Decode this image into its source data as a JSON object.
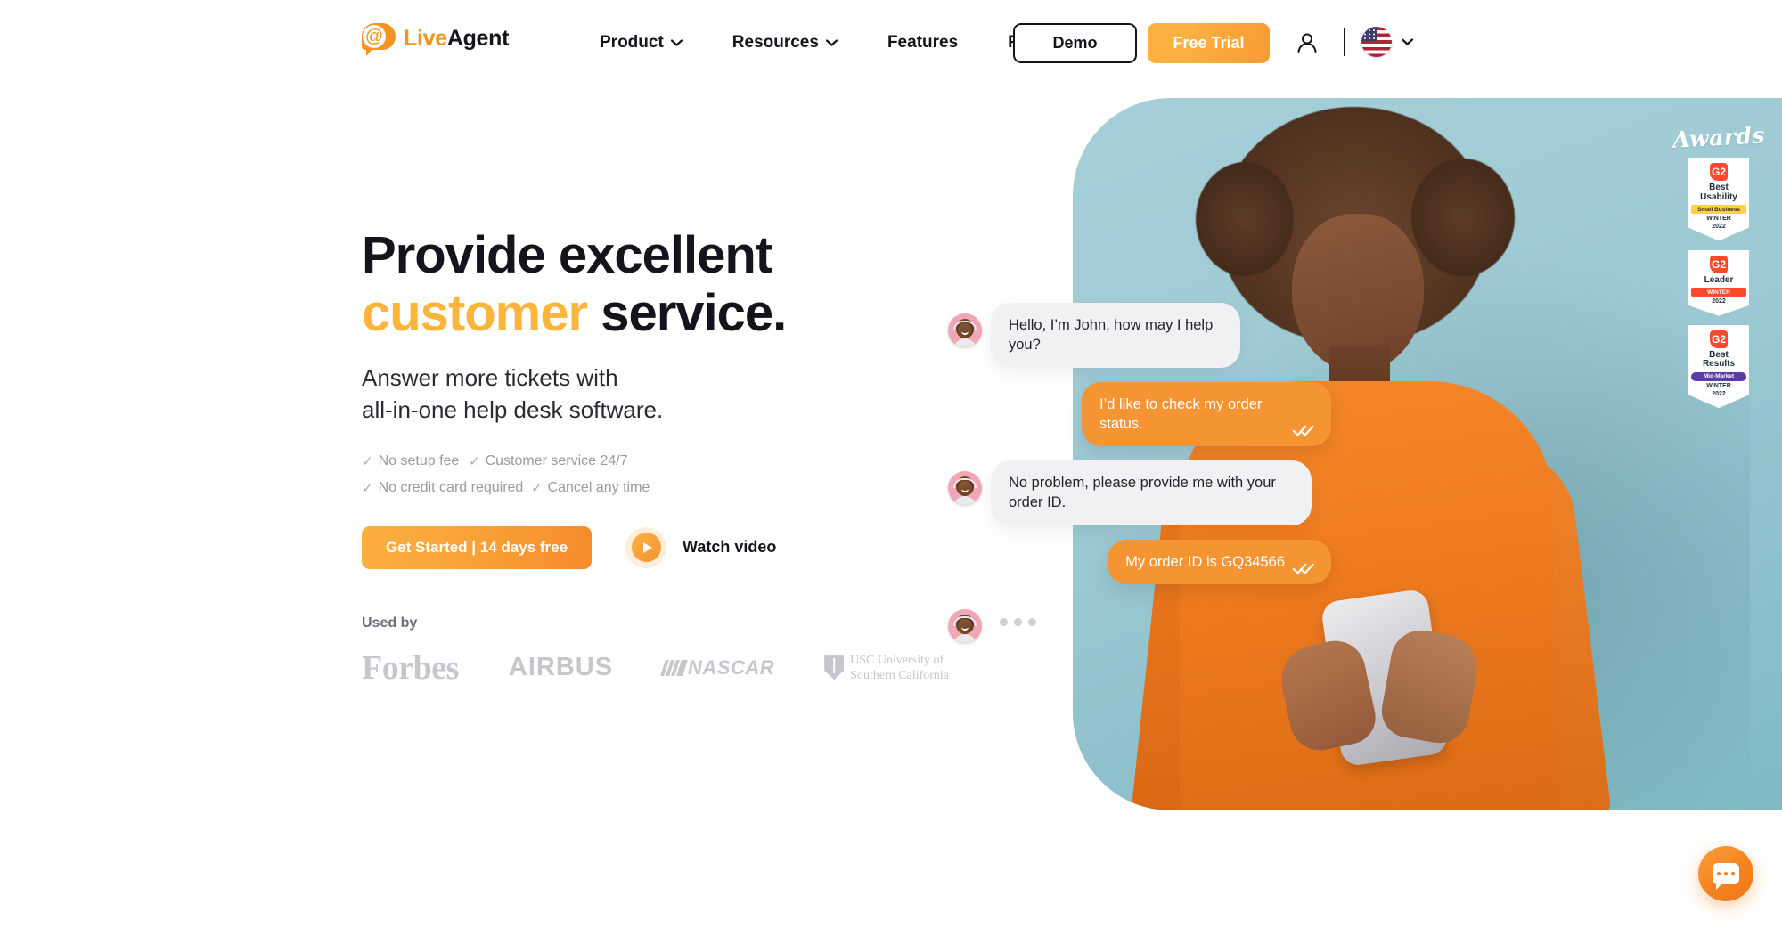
{
  "brand": {
    "name_part1": "Live",
    "name_part2": "Agent",
    "logo_glyph": "@",
    "accent": "#F6921E"
  },
  "header": {
    "nav": [
      {
        "label": "Product",
        "has_dropdown": true
      },
      {
        "label": "Resources",
        "has_dropdown": true
      },
      {
        "label": "Features",
        "has_dropdown": false
      },
      {
        "label": "Pricing",
        "has_dropdown": false
      }
    ],
    "demo_label": "Demo",
    "trial_label": "Free Trial",
    "language": "en-US"
  },
  "hero": {
    "headline_line1": "Provide excellent",
    "headline_accent": "customer",
    "headline_rest": " service.",
    "subhead_line1": "Answer more tickets with",
    "subhead_line2": "all-in-one help desk software.",
    "tick": "✓",
    "benefits": [
      "No setup fee",
      "Customer service 24/7",
      "No credit card required",
      "Cancel any time"
    ],
    "cta_primary": "Get Started | 14 days free",
    "cta_video": "Watch video",
    "usedby_label": "Used by",
    "logos": [
      {
        "name": "Forbes"
      },
      {
        "name": "AIRBUS"
      },
      {
        "name": "NASCAR"
      },
      {
        "name": "USC University of",
        "line2": "Southern California"
      }
    ],
    "accent_color": "#FBB53A"
  },
  "chat": {
    "messages": [
      {
        "from": "agent",
        "text": "Hello, I’m John, how may I help you?"
      },
      {
        "from": "user",
        "text": "I’d like to check my order status.",
        "status": "read"
      },
      {
        "from": "agent",
        "text": "No problem, please provide me with your order ID."
      },
      {
        "from": "user",
        "text": "My order ID is GQ34566",
        "status": "read"
      }
    ],
    "typing": true,
    "agent_bubble_color": "#F1F1F3",
    "user_bubble_color": "#F59432"
  },
  "awards": {
    "title": "Awards",
    "badges": [
      {
        "vendor": "G2",
        "title_line1": "Best",
        "title_line2": "Usability",
        "ribbon": "Small Business",
        "ribbon_color": "#FFD33D",
        "season": "WINTER",
        "year": "2022"
      },
      {
        "vendor": "G2",
        "title_line1": "Leader",
        "title_line2": "",
        "ribbon": "WINTER",
        "ribbon_color": "#FF492C",
        "season": "",
        "year": "2022"
      },
      {
        "vendor": "G2",
        "title_line1": "Best",
        "title_line2": "Results",
        "ribbon": "Mid-Market",
        "ribbon_color": "#5B3BA6",
        "season": "WINTER",
        "year": "2022"
      }
    ]
  },
  "chat_widget": {
    "icon": "chat-bubble-icon",
    "color": "#F58220"
  }
}
